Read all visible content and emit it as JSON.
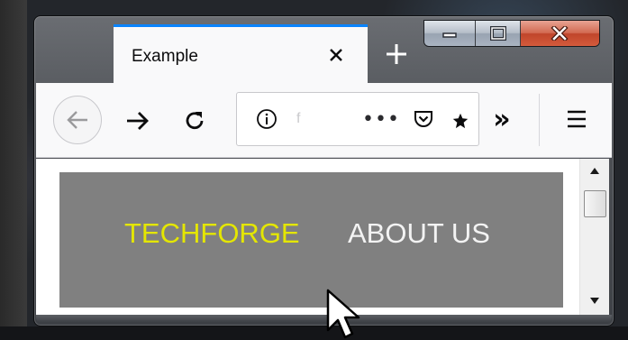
{
  "tab": {
    "title": "Example"
  },
  "toolbar": {
    "url_text": "f",
    "page_actions_glyph": "•••",
    "overflow_glyph": "»"
  },
  "page": {
    "nav": {
      "brand": "TECHFORGE",
      "about": "ABOUT US"
    }
  },
  "icons": {
    "tab_close": "close-icon",
    "new_tab": "plus-icon",
    "minimize": "minimize-icon",
    "maximize": "maximize-icon",
    "close_window": "close-icon",
    "back": "arrow-left-icon",
    "forward": "arrow-right-icon",
    "reload": "reload-icon",
    "site_info": "info-icon",
    "pocket": "pocket-icon",
    "bookmark": "star-icon",
    "menu": "hamburger-menu-icon",
    "scroll_up": "triangle-up-icon",
    "scroll_down": "triangle-down-icon",
    "cursor": "mouse-pointer-icon"
  },
  "colors": {
    "tab_accent": "#0a84ff",
    "nav_background": "#808080",
    "brand_text": "#e4e600",
    "about_text": "#f3f3f3",
    "window_close": "#c0452a"
  }
}
